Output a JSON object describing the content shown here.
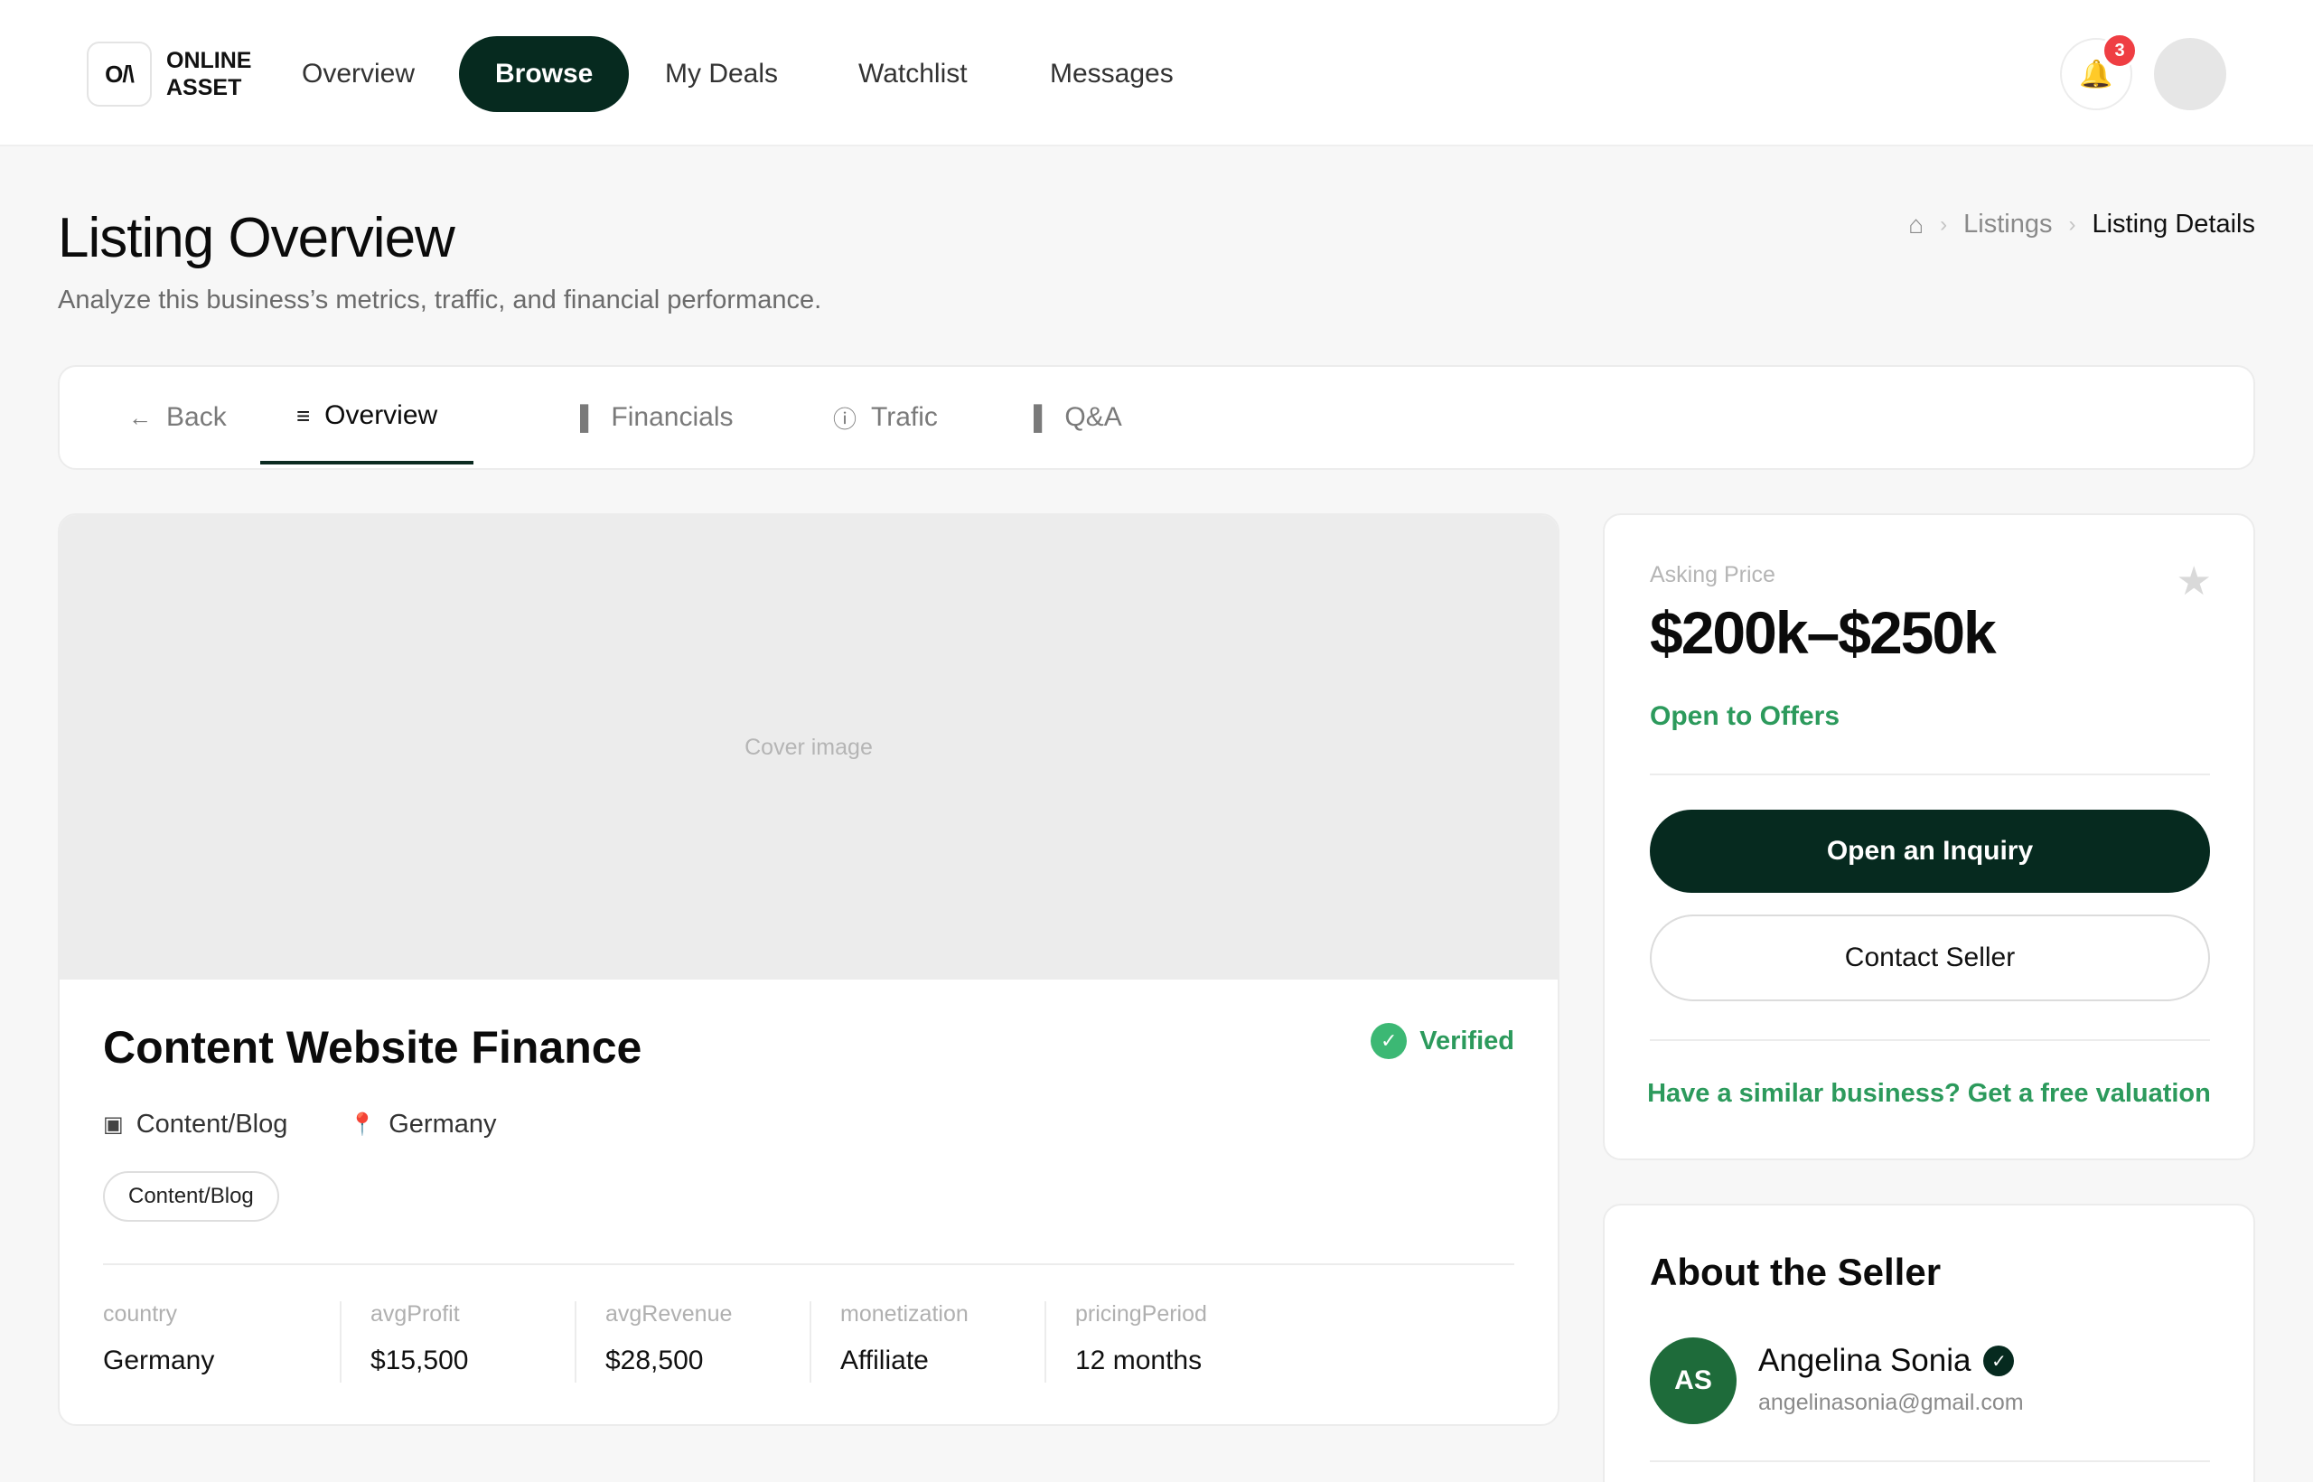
{
  "brand": {
    "logo_mark": "O/\\",
    "name_line1": "ONLINE",
    "name_line2": "ASSET"
  },
  "nav": {
    "items": [
      {
        "label": "Overview"
      },
      {
        "label": "Browse",
        "active": true
      },
      {
        "label": "My Deals"
      },
      {
        "label": "Watchlist"
      },
      {
        "label": "Messages"
      }
    ],
    "notification_count": "3",
    "icons": {
      "bell": "bell-icon",
      "avatar": "user-avatar"
    }
  },
  "header": {
    "title": "Listing Overview",
    "subtitle": "Analyze this business’s metrics, traffic, and financial performance."
  },
  "breadcrumb": {
    "home_icon": "⌂",
    "items": [
      "Listings",
      "Listing Details"
    ]
  },
  "tabs": [
    {
      "label": "Back",
      "icon": "←"
    },
    {
      "label": "Overview",
      "icon": "≡",
      "active": true
    },
    {
      "label": "Financials",
      "icon": "▌"
    },
    {
      "label": "Trafic",
      "icon": "ⓘ"
    },
    {
      "label": "Q&A",
      "icon": "▌"
    }
  ],
  "listing": {
    "cover_placeholder": "Cover image",
    "title": "Content Website Finance",
    "verified_label": "Verified",
    "category": "Content/Blog",
    "location": "Germany",
    "tag": "Content/Blog",
    "stats": [
      {
        "label": "country",
        "value": "Germany"
      },
      {
        "label": "avgProfit",
        "value": "$15,500"
      },
      {
        "label": "avgRevenue",
        "value": "$28,500"
      },
      {
        "label": "monetization",
        "value": "Affiliate"
      },
      {
        "label": "pricingPeriod",
        "value": "12 months"
      }
    ]
  },
  "price_card": {
    "label": "Asking Price",
    "value": "$200k–$250k",
    "offers": "Open to Offers",
    "inquiry_button": "Open an Inquiry",
    "contact_button": "Contact Seller",
    "valuation_link": "Have a similar business? Get a free valuation"
  },
  "seller": {
    "section_title": "About the Seller",
    "initials": "AS",
    "name": "Angelina Sonia",
    "email": "angelinasonia@gmail.com"
  },
  "colors": {
    "brand_dark": "#062a1f",
    "accent_green": "#2c9a5c",
    "badge_red": "#ef3e43",
    "avatar_green": "#1e6b3a"
  }
}
